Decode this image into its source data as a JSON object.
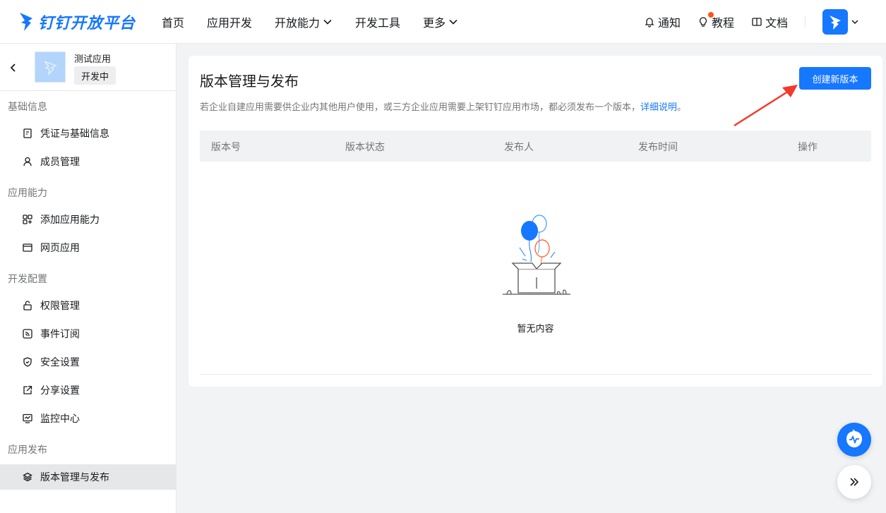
{
  "header": {
    "logo_text": "钉钉开放平台",
    "nav": [
      {
        "label": "首页",
        "has_dropdown": false
      },
      {
        "label": "应用开发",
        "has_dropdown": false
      },
      {
        "label": "开放能力",
        "has_dropdown": true
      },
      {
        "label": "开发工具",
        "has_dropdown": false
      },
      {
        "label": "更多",
        "has_dropdown": true
      }
    ],
    "notify_label": "通知",
    "tutorial_label": "教程",
    "docs_label": "文档"
  },
  "sidebar": {
    "app_name": "测试应用",
    "app_status": "开发中",
    "groups": [
      {
        "title": "基础信息",
        "items": [
          {
            "label": "凭证与基础信息",
            "icon": "credential-icon"
          },
          {
            "label": "成员管理",
            "icon": "user-icon"
          }
        ]
      },
      {
        "title": "应用能力",
        "items": [
          {
            "label": "添加应用能力",
            "icon": "apps-add-icon"
          },
          {
            "label": "网页应用",
            "icon": "browser-window-icon"
          }
        ]
      },
      {
        "title": "开发配置",
        "items": [
          {
            "label": "权限管理",
            "icon": "lock-icon"
          },
          {
            "label": "事件订阅",
            "icon": "rss-icon"
          },
          {
            "label": "安全设置",
            "icon": "shield-icon"
          },
          {
            "label": "分享设置",
            "icon": "share-icon"
          },
          {
            "label": "监控中心",
            "icon": "monitor-icon"
          }
        ]
      },
      {
        "title": "应用发布",
        "items": [
          {
            "label": "版本管理与发布",
            "icon": "layers-icon",
            "active": true
          }
        ]
      }
    ]
  },
  "main": {
    "title": "版本管理与发布",
    "description": "若企业自建应用需要供企业内其他用户使用，或三方企业应用需要上架钉钉应用市场，都必须发布一个版本，",
    "description_link": "详细说明",
    "description_end": "。",
    "create_button": "创建新版本",
    "table_columns": [
      "版本号",
      "版本状态",
      "发布人",
      "发布时间",
      "操作"
    ],
    "empty_text": "暂无内容"
  },
  "colors": {
    "primary": "#1677ff",
    "annotation_arrow": "#f5382c"
  }
}
